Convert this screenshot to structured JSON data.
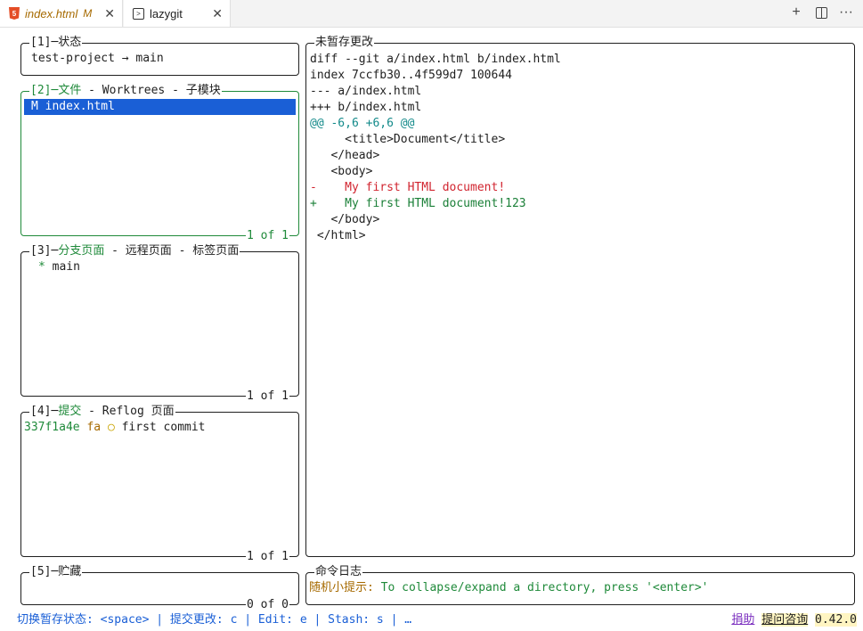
{
  "tabs": [
    {
      "title": "index.html",
      "modified": "M",
      "icon": "html5-icon",
      "close": "✕"
    },
    {
      "title": "lazygit",
      "icon": "terminal-icon",
      "close": "✕"
    }
  ],
  "toolbar": {
    "new": "+",
    "more": "···"
  },
  "panels": {
    "status": {
      "title": "[1]─状态",
      "line": "test-project → main"
    },
    "files": {
      "title_num": "[2]─",
      "title_active": "文件",
      "title_rest": " - Worktrees - 子模块",
      "selected": "M index.html",
      "footer": "1 of 1"
    },
    "branches": {
      "title_num": "[3]─",
      "title_active": "分支页面",
      "title_rest": " - 远程页面 - 标签页面",
      "item_star": "*",
      "item_name": " main",
      "footer": "1 of 1"
    },
    "commits": {
      "title_num": "[4]─",
      "title_active": "提交",
      "title_rest": " - Reflog 页面",
      "hash": "337f1a4e",
      "author": "fa",
      "graph": "○",
      "message": "first commit",
      "footer": "1 of 1"
    },
    "stash": {
      "title": "[5]─贮藏",
      "footer": "0 of 0"
    }
  },
  "diff": {
    "title": "未暂存更改",
    "lines": [
      {
        "text": "diff --git a/index.html b/index.html",
        "kind": "plain"
      },
      {
        "text": "index 7ccfb30..4f599d7 100644",
        "kind": "plain"
      },
      {
        "text": "--- a/index.html",
        "kind": "plain"
      },
      {
        "text": "+++ b/index.html",
        "kind": "plain"
      },
      {
        "text": "@@ -6,6 +6,6 @@",
        "kind": "hunk"
      },
      {
        "text": "     <title>Document</title>",
        "kind": "plain"
      },
      {
        "text": "   </head>",
        "kind": "plain"
      },
      {
        "text": "   <body>",
        "kind": "plain"
      },
      {
        "text": "-    My first HTML document!",
        "kind": "del"
      },
      {
        "text": "+    My first HTML document!123",
        "kind": "add"
      },
      {
        "text": "   </body>",
        "kind": "plain"
      },
      {
        "text": " </html>",
        "kind": "plain"
      }
    ]
  },
  "command_log": {
    "title": "命令日志",
    "tip_label": "随机小提示:",
    "tip_text": " To collapse/expand a directory, press '<enter>'"
  },
  "statusbar": {
    "left": "切换暂存状态: <space> | 提交更改: c | Edit: e | Stash: s | …",
    "donate": "捐助",
    "ask": "提问咨询",
    "version": "0.42.0"
  },
  "colors": {
    "active_border": "#1f8a3a",
    "selection": "#1a5fd6",
    "deleted": "#d1242f",
    "added": "#1a7f37"
  }
}
